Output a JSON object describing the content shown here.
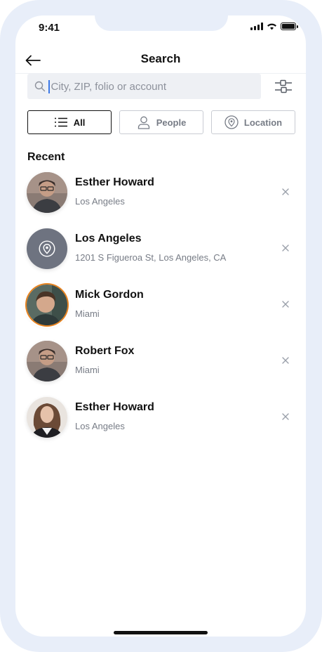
{
  "status_bar": {
    "time": "9:41"
  },
  "header": {
    "title": "Search"
  },
  "search": {
    "placeholder": "City, ZIP, folio or account",
    "value": ""
  },
  "tabs": [
    {
      "label": "All",
      "icon": "list-icon",
      "active": true
    },
    {
      "label": "People",
      "icon": "person-icon",
      "active": false
    },
    {
      "label": "Location",
      "icon": "location-pin-icon",
      "active": false
    }
  ],
  "recent": {
    "heading": "Recent",
    "items": [
      {
        "name": "Esther Howard",
        "subtitle": "Los Angeles",
        "type": "person"
      },
      {
        "name": "Los Angeles",
        "subtitle": "1201 S Figueroa St, Los Angeles, CA",
        "type": "location"
      },
      {
        "name": "Mick Gordon",
        "subtitle": "Miami",
        "type": "person",
        "highlighted": true
      },
      {
        "name": "Robert Fox",
        "subtitle": "Miami",
        "type": "person"
      },
      {
        "name": "Esther Howard",
        "subtitle": "Los Angeles",
        "type": "person"
      }
    ]
  },
  "colors": {
    "frame": "#e8eef9",
    "search_bg": "#eef0f4",
    "accent_ring": "#e8821d",
    "caret": "#3b78e7",
    "location_avatar": "#6e7380"
  }
}
